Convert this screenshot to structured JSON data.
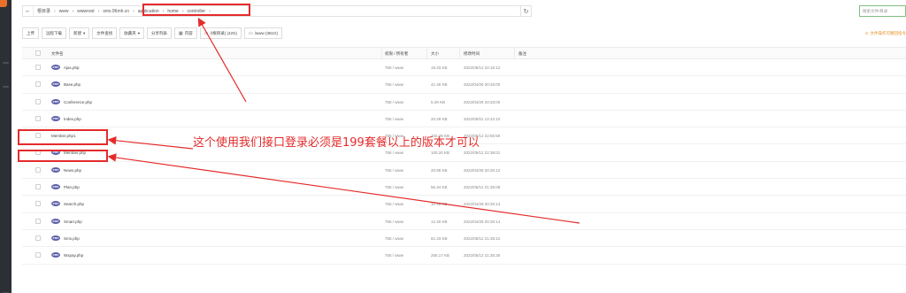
{
  "pathbar": {
    "back_icon": "arrow-left-icon",
    "crumbs": [
      "根目录",
      "www",
      "wwwroot",
      "sms.96mh.cn",
      "application",
      "home",
      "controller"
    ],
    "refresh_icon": "refresh-icon"
  },
  "search": {
    "placeholder": "搜索文件/目录"
  },
  "toolbar": {
    "upload": "上传",
    "remote_download": "远程下载",
    "new": "新建",
    "new_caret": "▾",
    "terminal": "文件查找",
    "favorites": "收藏夹",
    "favorites_caret": "▾",
    "share": "分享列表",
    "share_icon": "calendar-icon",
    "disk1": "/(根目录) (42G)",
    "disk2": "/www (361G)"
  },
  "hint": {
    "text": "文件操作可撤回指令"
  },
  "table": {
    "headers": {
      "name": "文件名",
      "perm": "权限 / 所有者",
      "size": "大小",
      "mtime": "修改时间",
      "remark": "备注"
    },
    "rows": [
      {
        "name": "Ajax.php",
        "perm": "755 / www",
        "size": "19.33 KB",
        "mtime": "2022/05/12 22:15:12"
      },
      {
        "name": "Base.php",
        "perm": "755 / www",
        "size": "41.46 KB",
        "mtime": "2022/04/29 20:26:00"
      },
      {
        "name": "Conference.php",
        "perm": "755 / www",
        "size": "5.29 KB",
        "mtime": "2022/04/29 20:26:00"
      },
      {
        "name": "Index.php",
        "perm": "755 / www",
        "size": "20.29 KB",
        "mtime": "2022/05/01 12:43:10"
      },
      {
        "name": "Member.php1",
        "perm": "755 / www",
        "size": "102.48 KB",
        "mtime": "2022/05/12 22:55:50"
      },
      {
        "name": "Member.php",
        "perm": "755 / www",
        "size": "100.20 KB",
        "mtime": "2022/05/12 22:38:01"
      },
      {
        "name": "News.php",
        "perm": "755 / www",
        "size": "20.99 KB",
        "mtime": "2022/04/29 20:26:12"
      },
      {
        "name": "Plan.php",
        "perm": "755 / www",
        "size": "56.34 KB",
        "mtime": "2022/05/12 21:35:06"
      },
      {
        "name": "Search.php",
        "perm": "755 / www",
        "size": "10.99 KB",
        "mtime": "2022/04/29 20:26:14"
      },
      {
        "name": "Smart.php",
        "perm": "755 / www",
        "size": "12.40 KB",
        "mtime": "2022/04/29 20:26:14"
      },
      {
        "name": "Sms.php",
        "perm": "755 / www",
        "size": "61.33 KB",
        "mtime": "2022/05/12 21:35:12"
      },
      {
        "name": "Wxpay.php",
        "perm": "755 / www",
        "size": "255.17 KB",
        "mtime": "2022/05/12 21:35:30"
      }
    ],
    "file_icon_label": "PHP"
  },
  "annotation": {
    "text": "这个使用我们接口登录必须是199套餐以上的版本才可以"
  },
  "colors": {
    "annotation_red": "#e52b2b",
    "php_icon": "#5b5fa8",
    "search_border": "#7ec07e"
  }
}
